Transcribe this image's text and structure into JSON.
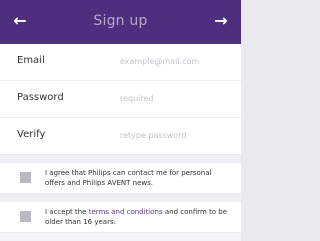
{
  "header": {
    "title": "Sign up",
    "back_icon": "arrow-left-icon",
    "next_icon": "arrow-right-icon",
    "back_glyph": "←",
    "next_glyph": "→",
    "background_color": "#4d2f7e"
  },
  "form": {
    "fields": [
      {
        "label": "Email",
        "placeholder": "example@mail.com"
      },
      {
        "label": "Password",
        "placeholder": "required"
      },
      {
        "label": "Verify",
        "placeholder": "retype password"
      }
    ]
  },
  "consents": {
    "marketing": {
      "text": "I agree that Philips can contact me for personal offers and Philips AVENT news."
    },
    "terms": {
      "prefix": "I accept the ",
      "link": "terms and conditions",
      "suffix": " and confirm to be older than 16 years."
    }
  }
}
